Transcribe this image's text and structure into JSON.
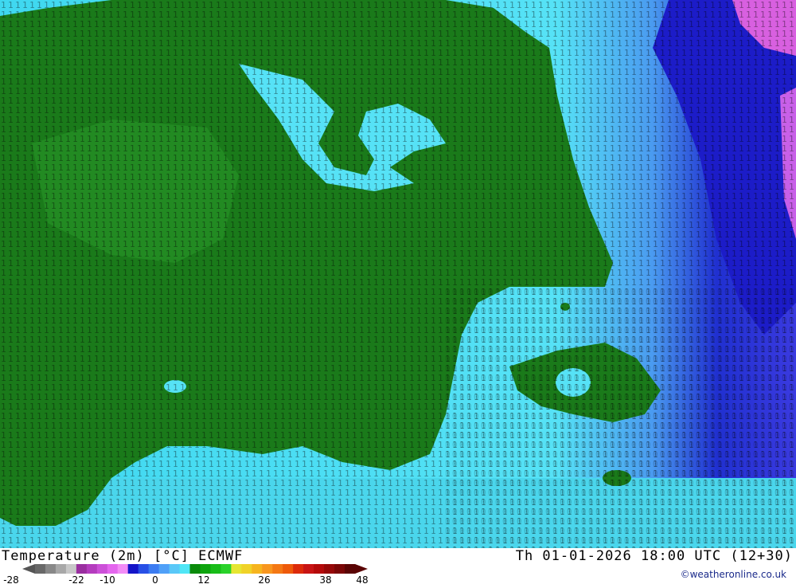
{
  "title": {
    "left": "Temperature (2m) [°C] ECMWF",
    "right": "Th 01-01-2026 18:00 UTC (12+30)"
  },
  "credit": "©weatheronline.co.uk",
  "colors": {
    "land": "#1a7a1a",
    "land_dark": "#0e6a0e",
    "sea_cyan": "#3fd8f0",
    "sea_light": "#7ff0ff",
    "sea_blue": "#3b6cf0",
    "deep_blue": "#1a1ac8",
    "magenta": "#e060e0"
  },
  "scale": {
    "labels": [
      "-28",
      "-22",
      "-10",
      "0",
      "12",
      "26",
      "38",
      "48"
    ],
    "colors": [
      "#686868",
      "#888888",
      "#a8a8a8",
      "#c8c8c8",
      "#9a2fa0",
      "#b43cbe",
      "#cc50d8",
      "#e466ee",
      "#f28cf6",
      "#1414c8",
      "#2850e6",
      "#3c7cf2",
      "#50a0f8",
      "#5ac8f8",
      "#50e6f6",
      "#0a8a0a",
      "#0ea40e",
      "#18bc18",
      "#2ad22a",
      "#e6e632",
      "#f0d228",
      "#f6b41e",
      "#f8961e",
      "#f47814",
      "#ee5a0a",
      "#dc2a0a",
      "#c81414",
      "#b40a0a",
      "#960808",
      "#7a0606",
      "#5a0404"
    ]
  }
}
